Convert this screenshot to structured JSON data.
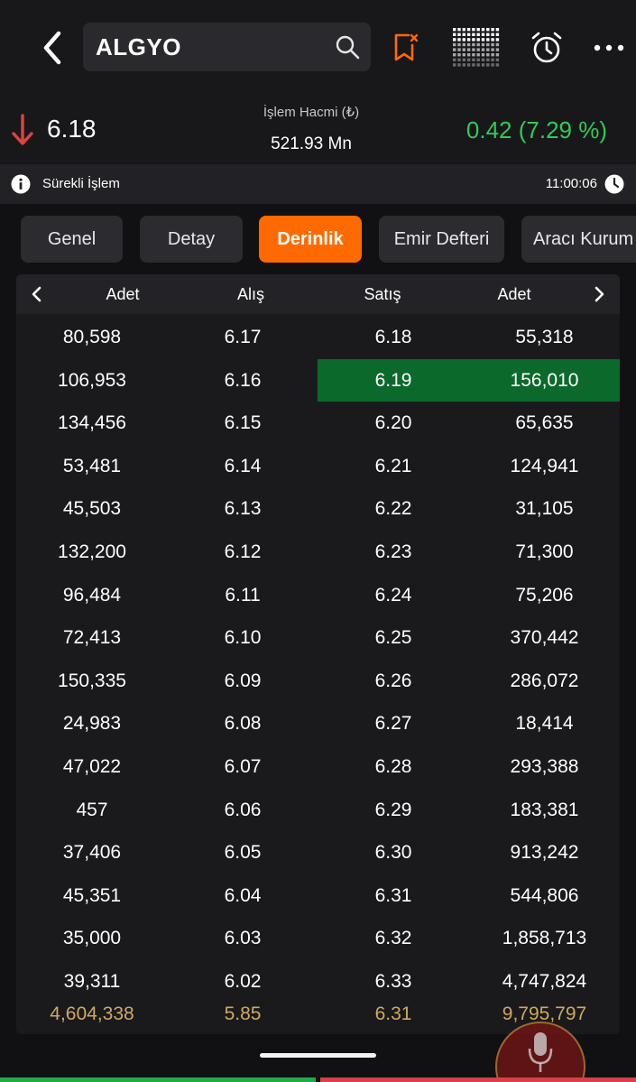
{
  "header": {
    "search_value": "ALGYO",
    "icons": [
      "back-arrow-icon",
      "search-icon",
      "bookmark-remove-icon",
      "grid-chart-icon",
      "alarm-icon",
      "more-icon"
    ]
  },
  "price": {
    "last": "6.18",
    "volume_label": "İşlem Hacmi (₺)",
    "volume_value": "521.93 Mn",
    "change": "0.42 (7.29 %)",
    "change_color": "#2ecc55",
    "down_color": "#e0443c"
  },
  "status": {
    "session": "Sürekli İşlem",
    "time": "11:00:06"
  },
  "tabs": [
    {
      "label": "Genel",
      "active": false
    },
    {
      "label": "Detay",
      "active": false
    },
    {
      "label": "Derinlik",
      "active": true
    },
    {
      "label": "Emir Defteri",
      "active": false
    },
    {
      "label": "Aracı Kurum",
      "active": false
    }
  ],
  "accent_color": "#ff6a00",
  "depth": {
    "headers": [
      "Adet",
      "Alış",
      "Satış",
      "Adet"
    ],
    "rows": [
      {
        "bid_qty": "80,598",
        "bid": "6.17",
        "ask": "6.18",
        "ask_qty": "55,318",
        "highlight": false
      },
      {
        "bid_qty": "106,953",
        "bid": "6.16",
        "ask": "6.19",
        "ask_qty": "156,010",
        "highlight": true
      },
      {
        "bid_qty": "134,456",
        "bid": "6.15",
        "ask": "6.20",
        "ask_qty": "65,635",
        "highlight": false
      },
      {
        "bid_qty": "53,481",
        "bid": "6.14",
        "ask": "6.21",
        "ask_qty": "124,941",
        "highlight": false
      },
      {
        "bid_qty": "45,503",
        "bid": "6.13",
        "ask": "6.22",
        "ask_qty": "31,105",
        "highlight": false
      },
      {
        "bid_qty": "132,200",
        "bid": "6.12",
        "ask": "6.23",
        "ask_qty": "71,300",
        "highlight": false
      },
      {
        "bid_qty": "96,484",
        "bid": "6.11",
        "ask": "6.24",
        "ask_qty": "75,206",
        "highlight": false
      },
      {
        "bid_qty": "72,413",
        "bid": "6.10",
        "ask": "6.25",
        "ask_qty": "370,442",
        "highlight": false
      },
      {
        "bid_qty": "150,335",
        "bid": "6.09",
        "ask": "6.26",
        "ask_qty": "286,072",
        "highlight": false
      },
      {
        "bid_qty": "24,983",
        "bid": "6.08",
        "ask": "6.27",
        "ask_qty": "18,414",
        "highlight": false
      },
      {
        "bid_qty": "47,022",
        "bid": "6.07",
        "ask": "6.28",
        "ask_qty": "293,388",
        "highlight": false
      },
      {
        "bid_qty": "457",
        "bid": "6.06",
        "ask": "6.29",
        "ask_qty": "183,381",
        "highlight": false
      },
      {
        "bid_qty": "37,406",
        "bid": "6.05",
        "ask": "6.30",
        "ask_qty": "913,242",
        "highlight": false
      },
      {
        "bid_qty": "45,351",
        "bid": "6.04",
        "ask": "6.31",
        "ask_qty": "544,806",
        "highlight": false
      },
      {
        "bid_qty": "35,000",
        "bid": "6.03",
        "ask": "6.32",
        "ask_qty": "1,858,713",
        "highlight": false
      },
      {
        "bid_qty": "39,311",
        "bid": "6.02",
        "ask": "6.33",
        "ask_qty": "4,747,824",
        "highlight": false
      }
    ],
    "totals": {
      "bid_qty": "4,604,338",
      "bid": "5.85",
      "ask": "6.31",
      "ask_qty": "9,795,797"
    },
    "highlight_color": "#0b6a2b",
    "totals_color": "#cfa960"
  }
}
